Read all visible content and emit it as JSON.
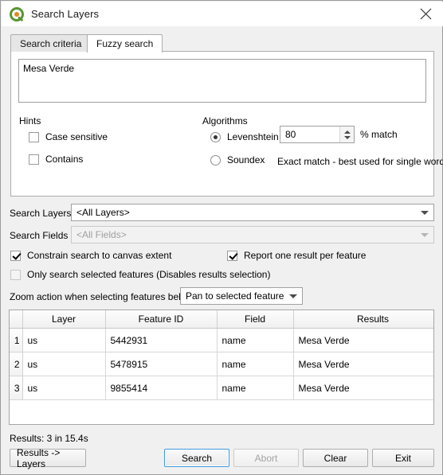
{
  "window": {
    "title": "Search Layers",
    "icon": "qgis-logo-icon",
    "close_icon": "close-icon"
  },
  "tabs": [
    {
      "label": "Search criteria",
      "selected": false
    },
    {
      "label": "Fuzzy search",
      "selected": true
    }
  ],
  "fuzzy_search": {
    "query_text": "Mesa Verde",
    "hints": {
      "label": "Hints",
      "items": [
        {
          "label": "Case sensitive",
          "checked": false
        },
        {
          "label": "Contains",
          "checked": false
        }
      ]
    },
    "algorithms": {
      "label": "Algorithms",
      "options": [
        {
          "label": "Levenshtein",
          "selected": true
        },
        {
          "label": "Soundex",
          "selected": false
        }
      ],
      "percent_match": "80",
      "percent_match_suffix": "% match",
      "soundex_hint": "Exact match - best used for single words"
    }
  },
  "filters": {
    "search_layers_label": "Search Layers",
    "search_layers_value": "<All Layers>",
    "search_fields_label": "Search Fields",
    "search_fields_value": "<All Fields>",
    "search_fields_disabled": true
  },
  "options": [
    {
      "label": "Constrain search to canvas extent",
      "checked": true
    },
    {
      "label": "Report one result per feature",
      "checked": true
    },
    {
      "label": "Only search selected features (Disables results selection)",
      "checked": false
    }
  ],
  "zoom_action": {
    "label": "Zoom action when selecting features below",
    "value": "Pan to selected features"
  },
  "results_table": {
    "columns": [
      "Layer",
      "Feature ID",
      "Field",
      "Results"
    ],
    "rows": [
      {
        "num": "1",
        "layer": "us",
        "feature_id": "5442931",
        "field": "name",
        "result": "Mesa Verde"
      },
      {
        "num": "2",
        "layer": "us",
        "feature_id": "5478915",
        "field": "name",
        "result": "Mesa Verde"
      },
      {
        "num": "3",
        "layer": "us",
        "feature_id": "9855414",
        "field": "name",
        "result": "Mesa Verde"
      }
    ]
  },
  "status": "Results: 3 in 15.4s",
  "buttons": {
    "results_to_layers": "Results -> Layers",
    "search": "Search",
    "abort": "Abort",
    "clear": "Clear",
    "exit": "Exit"
  },
  "colors": {
    "dialog_bg": "#f0f0f0",
    "panel_bg": "#ffffff",
    "focus_blue": "#3d9ae2",
    "qgis_green": "#589632",
    "qgis_orange": "#e08a1e"
  }
}
